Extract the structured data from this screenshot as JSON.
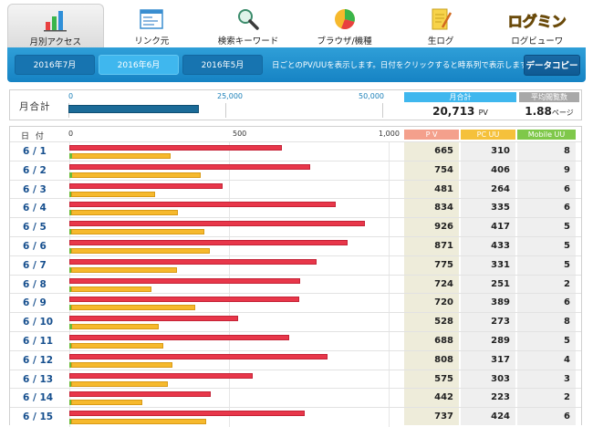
{
  "nav": [
    {
      "label": "月別アクセス",
      "icon": "bar-chart-icon",
      "active": true
    },
    {
      "label": "リンク元",
      "icon": "window-icon",
      "active": false
    },
    {
      "label": "検索キーワード",
      "icon": "magnifier-icon",
      "active": false
    },
    {
      "label": "ブラウザ/機種",
      "icon": "pie-chart-icon",
      "active": false
    },
    {
      "label": "生ログ",
      "icon": "notepad-pencil-icon",
      "active": false
    },
    {
      "label": "ログビューワ",
      "icon": "logbiewer-logo-icon",
      "active": false
    }
  ],
  "logo_text": "ログミン",
  "months": [
    {
      "label": "2016年7月",
      "active": false
    },
    {
      "label": "2016年6月",
      "active": true
    },
    {
      "label": "2016年5月",
      "active": false
    }
  ],
  "toolbar": {
    "note": "日ごとのPV/UUを表示します。日付をクリックすると時系列で表示します。",
    "copy_label": "データコピー"
  },
  "summary": {
    "label": "月合計",
    "axis_ticks": [
      "0",
      "25,000",
      "50,000"
    ],
    "axis_max": 50000,
    "total_pv": 20713,
    "pv_head": "月合計",
    "pv_value": "20,713",
    "pv_unit": "PV",
    "avg_head": "平均閲覧数",
    "avg_value": "1.88",
    "avg_unit": "ページ"
  },
  "table": {
    "date_head": "日 付",
    "axis_ticks": [
      "0",
      "500",
      "1,000"
    ],
    "axis_max": 1000,
    "col_pv": "P V",
    "col_pc": "PC UU",
    "col_mobile": "Mobile UU"
  },
  "colors": {
    "pv": "#e8374a",
    "pc_uu": "#f6b92d",
    "mobile_uu": "#6bbb38",
    "accent": "#1683c4"
  },
  "chart_data": {
    "type": "bar",
    "categories": [
      "6 / 1",
      "6 / 2",
      "6 / 3",
      "6 / 4",
      "6 / 5",
      "6 / 6",
      "6 / 7",
      "6 / 8",
      "6 / 9",
      "6 / 10",
      "6 / 11",
      "6 / 12",
      "6 / 13",
      "6 / 14",
      "6 / 15"
    ],
    "series": [
      {
        "name": "P V",
        "values": [
          665,
          754,
          481,
          834,
          926,
          871,
          775,
          724,
          720,
          528,
          688,
          808,
          575,
          442,
          737
        ]
      },
      {
        "name": "PC UU",
        "values": [
          310,
          406,
          264,
          335,
          417,
          433,
          331,
          251,
          389,
          273,
          289,
          317,
          303,
          223,
          424
        ]
      },
      {
        "name": "Mobile UU",
        "values": [
          8,
          9,
          6,
          6,
          5,
          5,
          5,
          2,
          6,
          8,
          5,
          4,
          3,
          2,
          6
        ]
      }
    ],
    "xlim": [
      0,
      1000
    ]
  }
}
